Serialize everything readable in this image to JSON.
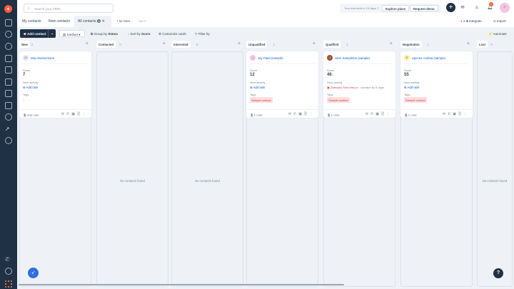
{
  "top": {
    "search_placeholder": "Search your CRM...",
    "trial_text": "Your trial ends in 15 days",
    "explore_plans": "Explore plans",
    "request_demo": "Request demo",
    "notif_count": "1",
    "avatar_letter": "P",
    "integrate": "Integrate",
    "import": "Import"
  },
  "tabs": [
    {
      "label": "My contacts"
    },
    {
      "label": "New contacts"
    },
    {
      "label": "All contacts",
      "badge": "5"
    },
    {
      "label": "+ 11 more..."
    },
    {
      "label": "Ctrl O"
    }
  ],
  "toolbar": {
    "add_contact": "Add contact",
    "view": "Kanban",
    "group_by": "Group by",
    "group_val": "Status",
    "sort_by": "Sort by",
    "sort_val": "Score",
    "customize": "Customize cards",
    "filter": "Filter by",
    "automate": "Automate"
  },
  "columns": [
    {
      "name": "New",
      "count": "2",
      "empty": ""
    },
    {
      "name": "Contacted",
      "count": "0",
      "empty": "No contacts found"
    },
    {
      "name": "Interested",
      "count": "0",
      "empty": "No contacts found"
    },
    {
      "name": "Unqualified",
      "count": "1",
      "empty": ""
    },
    {
      "name": "Qualified",
      "count": "1",
      "empty": ""
    },
    {
      "name": "Negotiation",
      "count": "1",
      "empty": ""
    },
    {
      "name": "Lost",
      "count": "0",
      "empty": "No contacts found"
    }
  ],
  "labels": {
    "score": "Score",
    "next": "Next activity",
    "tags": "Tags",
    "add_task": "Add task",
    "add_note": "Add note"
  },
  "cards": [
    {
      "name": "Max Mustermann",
      "initial": "M",
      "score": "7",
      "tag": "--",
      "note": "Add note"
    },
    {
      "name": "Jay Patel (sample)",
      "initial": "J",
      "score": "12",
      "tag": "Sample contact",
      "note": "1 note"
    },
    {
      "name": "Jane Sampleton (sample)",
      "initial": "J",
      "score": "46",
      "activity": "(Sample) Send the pr...",
      "overdue": "overdue by 5 days",
      "tag": "Sample contact",
      "note": "1 note"
    },
    {
      "name": "Spector Calista (sample)",
      "initial": "S",
      "score": "55",
      "tag": "Sample contact",
      "note": "1 note"
    }
  ],
  "colors": {
    "sidebar": "#1f3144",
    "accent": "#ff5c35",
    "link": "#0f5fd3"
  }
}
